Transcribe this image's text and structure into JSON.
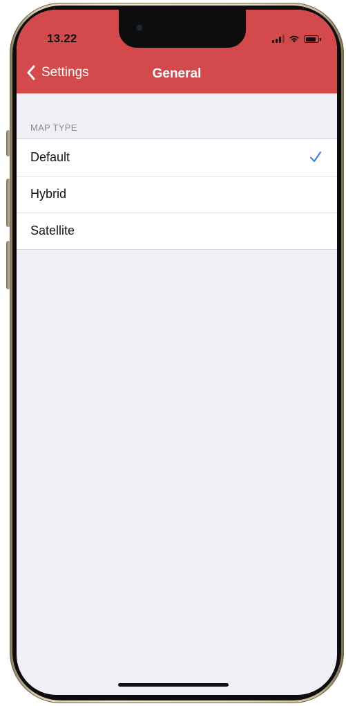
{
  "status_bar": {
    "time": "13.22",
    "icons": [
      "cellular-signal-icon",
      "wifi-icon",
      "battery-icon"
    ],
    "battery_level": 0.85
  },
  "nav_bar": {
    "back_label": "Settings",
    "back_icon": "chevron-left-icon",
    "title": "General"
  },
  "colors": {
    "header_bg": "#d4494c",
    "page_bg": "#f0eff5",
    "checkmark": "#3478f6"
  },
  "map_type": {
    "section_title": "MAP TYPE",
    "options": [
      {
        "label": "Default",
        "selected": true
      },
      {
        "label": "Hybrid",
        "selected": false
      },
      {
        "label": "Satellite",
        "selected": false
      }
    ]
  }
}
